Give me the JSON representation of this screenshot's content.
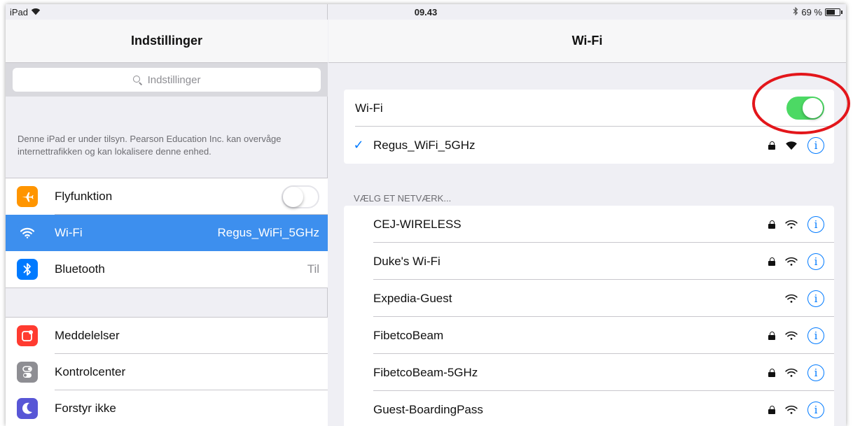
{
  "status": {
    "device": "iPad",
    "time": "09.43",
    "battery": "69 %",
    "battery_level": 0.69,
    "bluetooth_icon": "bluetooth-icon",
    "wifi_icon": "wifi-icon"
  },
  "master": {
    "title": "Indstillinger",
    "search_placeholder": "Indstillinger",
    "supervision_note": "Denne iPad er under tilsyn. Pearson Education Inc. kan overvåge internettrafikken og kan lokalisere denne enhed.",
    "items": [
      {
        "label": "Flyfunktion",
        "icon": "airplane-icon",
        "color": "#ff9500",
        "toggle": "off"
      },
      {
        "label": "Wi-Fi",
        "value": "Regus_WiFi_5GHz",
        "icon": "wifi-icon",
        "color": "#3d8fee",
        "selected": true
      },
      {
        "label": "Bluetooth",
        "value": "Til",
        "icon": "bluetooth-icon",
        "color": "#007aff"
      }
    ],
    "items2": [
      {
        "label": "Meddelelser",
        "icon": "notifications-icon",
        "color": "#ff3b30"
      },
      {
        "label": "Kontrolcenter",
        "icon": "control-center-icon",
        "color": "#8e8e93"
      },
      {
        "label": "Forstyr ikke",
        "icon": "moon-icon",
        "color": "#5856d6"
      }
    ]
  },
  "detail": {
    "title": "Wi-Fi",
    "wifi_label": "Wi-Fi",
    "wifi_enabled": true,
    "connected": {
      "name": "Regus_WiFi_5GHz",
      "locked": true
    },
    "section_header": "VÆLG ET NETVÆRK...",
    "networks": [
      {
        "name": "CEJ-WIRELESS",
        "locked": true
      },
      {
        "name": "Duke's Wi-Fi",
        "locked": true
      },
      {
        "name": "Expedia-Guest",
        "locked": false
      },
      {
        "name": "FibetcoBeam",
        "locked": true
      },
      {
        "name": "FibetcoBeam-5GHz",
        "locked": true
      },
      {
        "name": "Guest-BoardingPass",
        "locked": true
      }
    ],
    "info_glyph": "i"
  },
  "colors": {
    "accent": "#007aff",
    "toggle_on": "#4cd964",
    "annotation": "#e3161b"
  }
}
